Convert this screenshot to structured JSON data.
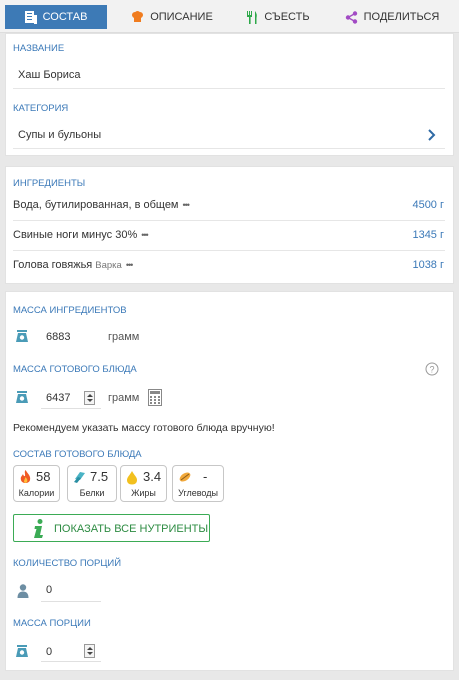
{
  "tabs": [
    {
      "label": "Состав",
      "active": true
    },
    {
      "label": "Описание",
      "active": false
    },
    {
      "label": "Съесть",
      "active": false
    },
    {
      "label": "Поделиться",
      "active": false
    }
  ],
  "recipe": {
    "name_label": "Название",
    "name_value": "Хаш Бориса",
    "category_label": "Категория",
    "category_value": "Супы и бульоны"
  },
  "ingredients": {
    "label": "Ингредиенты",
    "items": [
      {
        "name": "Вода, бутилированная, в общем",
        "note": "",
        "amount": "4500 г"
      },
      {
        "name": "Свиные ноги минус 30%",
        "note": "",
        "amount": "1345 г"
      },
      {
        "name": "Голова говяжья",
        "note": "Варка",
        "amount": "1038 г"
      }
    ]
  },
  "mass": {
    "ingredients_label": "Масса ингредиентов",
    "ingredients_value": "6883",
    "ingredients_unit": "грамм",
    "dish_label": "Масса готового блюда",
    "dish_value": "6437",
    "dish_unit": "грамм",
    "recommendation": "Рекомендуем указать массу готового блюда вручную!"
  },
  "composition": {
    "label": "Состав готового блюда",
    "items": [
      {
        "value": "58",
        "name": "Калории",
        "icon": "fire-icon"
      },
      {
        "value": "7.5",
        "name": "Белки",
        "icon": "protein-icon"
      },
      {
        "value": "3.4",
        "name": "Жиры",
        "icon": "fat-drop-icon"
      },
      {
        "value": "-",
        "name": "Углеводы",
        "icon": "carbs-icon"
      }
    ],
    "show_all_label": "Показать все нутриенты"
  },
  "portions": {
    "count_label": "Количество порций",
    "count_value": "0",
    "mass_label": "Масса порции",
    "mass_value": "0"
  },
  "colors": {
    "accent": "#3d7ab6",
    "label": "#3b79b8",
    "green": "#3bab55"
  }
}
